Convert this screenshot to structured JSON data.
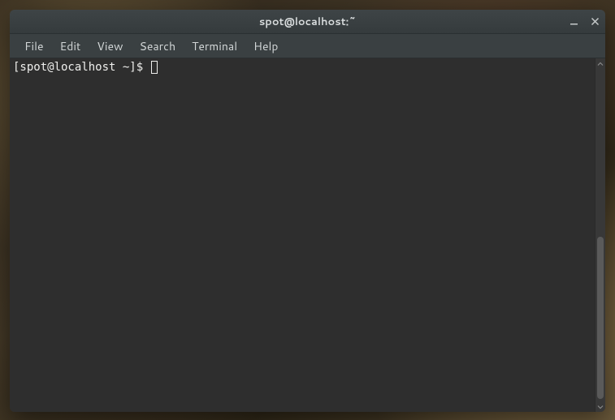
{
  "window": {
    "title": "spot@localhost:~"
  },
  "menubar": {
    "items": [
      {
        "label": "File"
      },
      {
        "label": "Edit"
      },
      {
        "label": "View"
      },
      {
        "label": "Search"
      },
      {
        "label": "Terminal"
      },
      {
        "label": "Help"
      }
    ]
  },
  "terminal": {
    "prompt": "[spot@localhost ~]$ "
  }
}
